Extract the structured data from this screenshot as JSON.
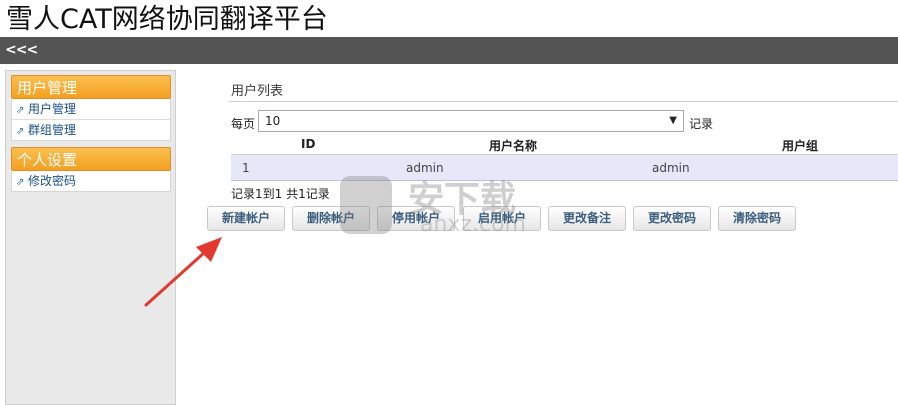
{
  "app": {
    "title": "雪人CAT网络协同翻译平台",
    "collapse_label": "<<<"
  },
  "sidebar": {
    "panels": [
      {
        "title": "用户管理",
        "items": [
          "用户管理",
          "群组管理"
        ]
      },
      {
        "title": "个人设置",
        "items": [
          "修改密码"
        ]
      }
    ],
    "link_icon_glyph": "⇗"
  },
  "main": {
    "section_title": "用户列表",
    "per_page_label": "每页",
    "per_page_value": "10",
    "per_page_arrow": "▼",
    "records_label": "记录",
    "table": {
      "columns": [
        "ID",
        "用户名称",
        "用户组"
      ],
      "rows": [
        {
          "id": "1",
          "username": "admin",
          "group": "admin"
        }
      ]
    },
    "summary": "记录1到1 共1记录",
    "buttons": [
      "新建帐户",
      "删除帐户",
      "停用帐户",
      "启用帐户",
      "更改备注",
      "更改密码",
      "清除密码"
    ]
  },
  "watermark": {
    "text": "安下载",
    "sub": "anxz.com"
  },
  "colors": {
    "topbar": "#545454",
    "panel_header": "#f5a623",
    "row_highlight": "#e6e8fa",
    "annotation_arrow": "#e23a2e"
  }
}
